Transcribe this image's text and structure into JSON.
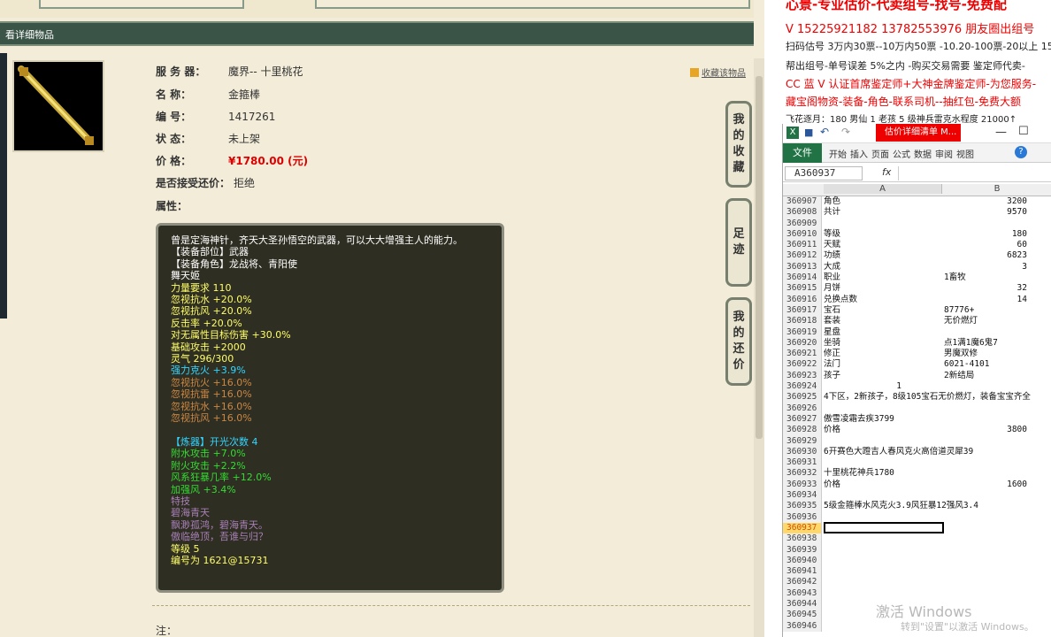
{
  "header_title": "看详细物品",
  "fav_label": "收藏该物品",
  "info": [
    {
      "key": "服 务 器：",
      "value": "魔界-- 十里桃花"
    },
    {
      "key": "名 称：",
      "value": "金箍棒"
    },
    {
      "key": "编 号：",
      "value": "1417261"
    },
    {
      "key": "状 态：",
      "value": "未上架"
    },
    {
      "key": "价 格：",
      "value": "¥1780.00 (元)"
    },
    {
      "key": "是否接受还价：",
      "value": "拒绝"
    },
    {
      "key": "属性：",
      "value": ""
    }
  ],
  "tooltip_lines": [
    {
      "t": "曾是定海神针，齐天大圣孙悟空的武器，可以大大增强主人的能力。",
      "c": "white"
    },
    {
      "t": "【装备部位】武器",
      "c": "white"
    },
    {
      "t": "【装备角色】龙战将、青阳使",
      "c": "white"
    },
    {
      "t": "舞天姬",
      "c": "white"
    },
    {
      "t": "力量要求 110",
      "c": "yellow"
    },
    {
      "t": "忽视抗水 +20.0%",
      "c": "yellow"
    },
    {
      "t": "忽视抗风 +20.0%",
      "c": "yellow"
    },
    {
      "t": "反击率 +20.0%",
      "c": "yellow"
    },
    {
      "t": "对无属性目标伤害 +30.0%",
      "c": "yellow"
    },
    {
      "t": "基础攻击 +2000",
      "c": "yellow"
    },
    {
      "t": "灵气 296/300",
      "c": "yellow"
    },
    {
      "t": "强力克火 +3.9%",
      "c": "cyan"
    },
    {
      "t": "忽视抗火 +16.0%",
      "c": "orange"
    },
    {
      "t": "忽视抗雷 +16.0%",
      "c": "orange"
    },
    {
      "t": "忽视抗水 +16.0%",
      "c": "orange"
    },
    {
      "t": "忽视抗风 +16.0%",
      "c": "orange"
    },
    {
      "t": "",
      "c": "white"
    },
    {
      "t": "【炼器】开光次数 4",
      "c": "cyan"
    },
    {
      "t": "附水攻击 +7.0%",
      "c": "green"
    },
    {
      "t": "附火攻击 +2.2%",
      "c": "green"
    },
    {
      "t": "风系狂暴几率 +12.0%",
      "c": "green"
    },
    {
      "t": "加强风 +3.4%",
      "c": "green"
    },
    {
      "t": "特技",
      "c": "purple"
    },
    {
      "t": "碧海青天",
      "c": "purple"
    },
    {
      "t": "飘渺孤鸿，碧海青天。",
      "c": "purple"
    },
    {
      "t": "傲临绝顶，吾谁与归？",
      "c": "purple"
    },
    {
      "t": "等级 5",
      "c": "yellow"
    },
    {
      "t": "编号为 1621@15731",
      "c": "yellow"
    }
  ],
  "side_buttons": [
    "我的收藏",
    "足迹",
    "我的还价"
  ],
  "note_label": "注：",
  "ads": [
    {
      "t": "心景-专业估价-代卖组号-找号-免费配",
      "red": true
    },
    {
      "t": "V 15225921182   13782553976 朋友圈出组号",
      "red": true
    },
    {
      "t": "扫码估号 3万内30票--10万内50票 -10.20-100票-20以上 15",
      "red": false
    },
    {
      "t": "帮出组号-单号误差 5%之内 -购买交易需要 鉴定师代卖-",
      "red": false
    },
    {
      "t": "CC 蓝 V 认证首席鉴定师+大神金牌鉴定师-为您服务-",
      "red": true
    },
    {
      "t": "藏宝阁物资-装备-角色-联系司机--抽红包-免费大额",
      "red": true
    },
    {
      "t": "飞花逐月：180 男仙 1 老孩 5 级神兵雷克水程度 21000↑",
      "red": false
    }
  ],
  "excel": {
    "title_btn": "估价详细清单 M...",
    "file_tab": "文件",
    "tabs": [
      "开始",
      "插入",
      "页面",
      "公式",
      "数据",
      "审阅",
      "视图"
    ],
    "name_box": "A360937",
    "fx": "fx",
    "col_a": "A",
    "col_b": "B",
    "rows": [
      {
        "n": "360907",
        "a": "角色",
        "b": "3200"
      },
      {
        "n": "360908",
        "a": "共计",
        "b": "9570"
      },
      {
        "n": "360909",
        "a": "",
        "b": ""
      },
      {
        "n": "360910",
        "a": "等级",
        "b": "180"
      },
      {
        "n": "360911",
        "a": "天赋",
        "b": "60"
      },
      {
        "n": "360912",
        "a": "功绩",
        "b": "6823"
      },
      {
        "n": "360913",
        "a": "大成",
        "b": "3"
      },
      {
        "n": "360914",
        "a": "职业",
        "b": "1畜牧"
      },
      {
        "n": "360915",
        "a": "月饼",
        "b": "32"
      },
      {
        "n": "360916",
        "a": "兑换点数",
        "b": "14"
      },
      {
        "n": "360917",
        "a": "宝石",
        "b": "87776+"
      },
      {
        "n": "360918",
        "a": "套装",
        "b": "无价燃灯"
      },
      {
        "n": "360919",
        "a": "星盘",
        "b": ""
      },
      {
        "n": "360920",
        "a": "坐骑",
        "b": "点1满1魔6鬼7"
      },
      {
        "n": "360921",
        "a": "修正",
        "b": "男魔双修"
      },
      {
        "n": "360922",
        "a": "法门",
        "b": "6021-4101"
      },
      {
        "n": "360923",
        "a": "孩子",
        "b": "2新结局"
      },
      {
        "n": "360924",
        "a": "1",
        "b": ""
      },
      {
        "n": "360925",
        "a": "4下区，2新孩子，8级105宝石无价燃灯，装备宝宝齐全",
        "b": ""
      },
      {
        "n": "360926",
        "a": "",
        "b": ""
      },
      {
        "n": "360927",
        "a": "傲雪凌霜去疾3799",
        "b": ""
      },
      {
        "n": "360928",
        "a": "价格",
        "b": "3800"
      },
      {
        "n": "360929",
        "a": "",
        "b": ""
      },
      {
        "n": "360930",
        "a": "6开赛色大蹬吉人春风克火高倍道灵犀39",
        "b": ""
      },
      {
        "n": "360931",
        "a": "",
        "b": ""
      },
      {
        "n": "360932",
        "a": "十里桃花神兵1780",
        "b": ""
      },
      {
        "n": "360933",
        "a": "价格",
        "b": "1600"
      },
      {
        "n": "360934",
        "a": "",
        "b": ""
      },
      {
        "n": "360935",
        "a": "5级金箍棒水风克火3.9风狂暴12强风3.4",
        "b": ""
      },
      {
        "n": "360936",
        "a": "",
        "b": ""
      },
      {
        "n": "360937",
        "a": "",
        "b": ""
      },
      {
        "n": "360938",
        "a": "",
        "b": ""
      },
      {
        "n": "360939",
        "a": "",
        "b": ""
      },
      {
        "n": "360940",
        "a": "",
        "b": ""
      },
      {
        "n": "360941",
        "a": "",
        "b": ""
      },
      {
        "n": "360942",
        "a": "",
        "b": ""
      },
      {
        "n": "360943",
        "a": "",
        "b": ""
      },
      {
        "n": "360944",
        "a": "",
        "b": ""
      },
      {
        "n": "360945",
        "a": "",
        "b": ""
      },
      {
        "n": "360946",
        "a": "",
        "b": ""
      }
    ],
    "selected_row": "360937"
  },
  "watermark": {
    "line1": "激活 Windows",
    "line2": "转到\"设置\"以激活 Windows。"
  }
}
